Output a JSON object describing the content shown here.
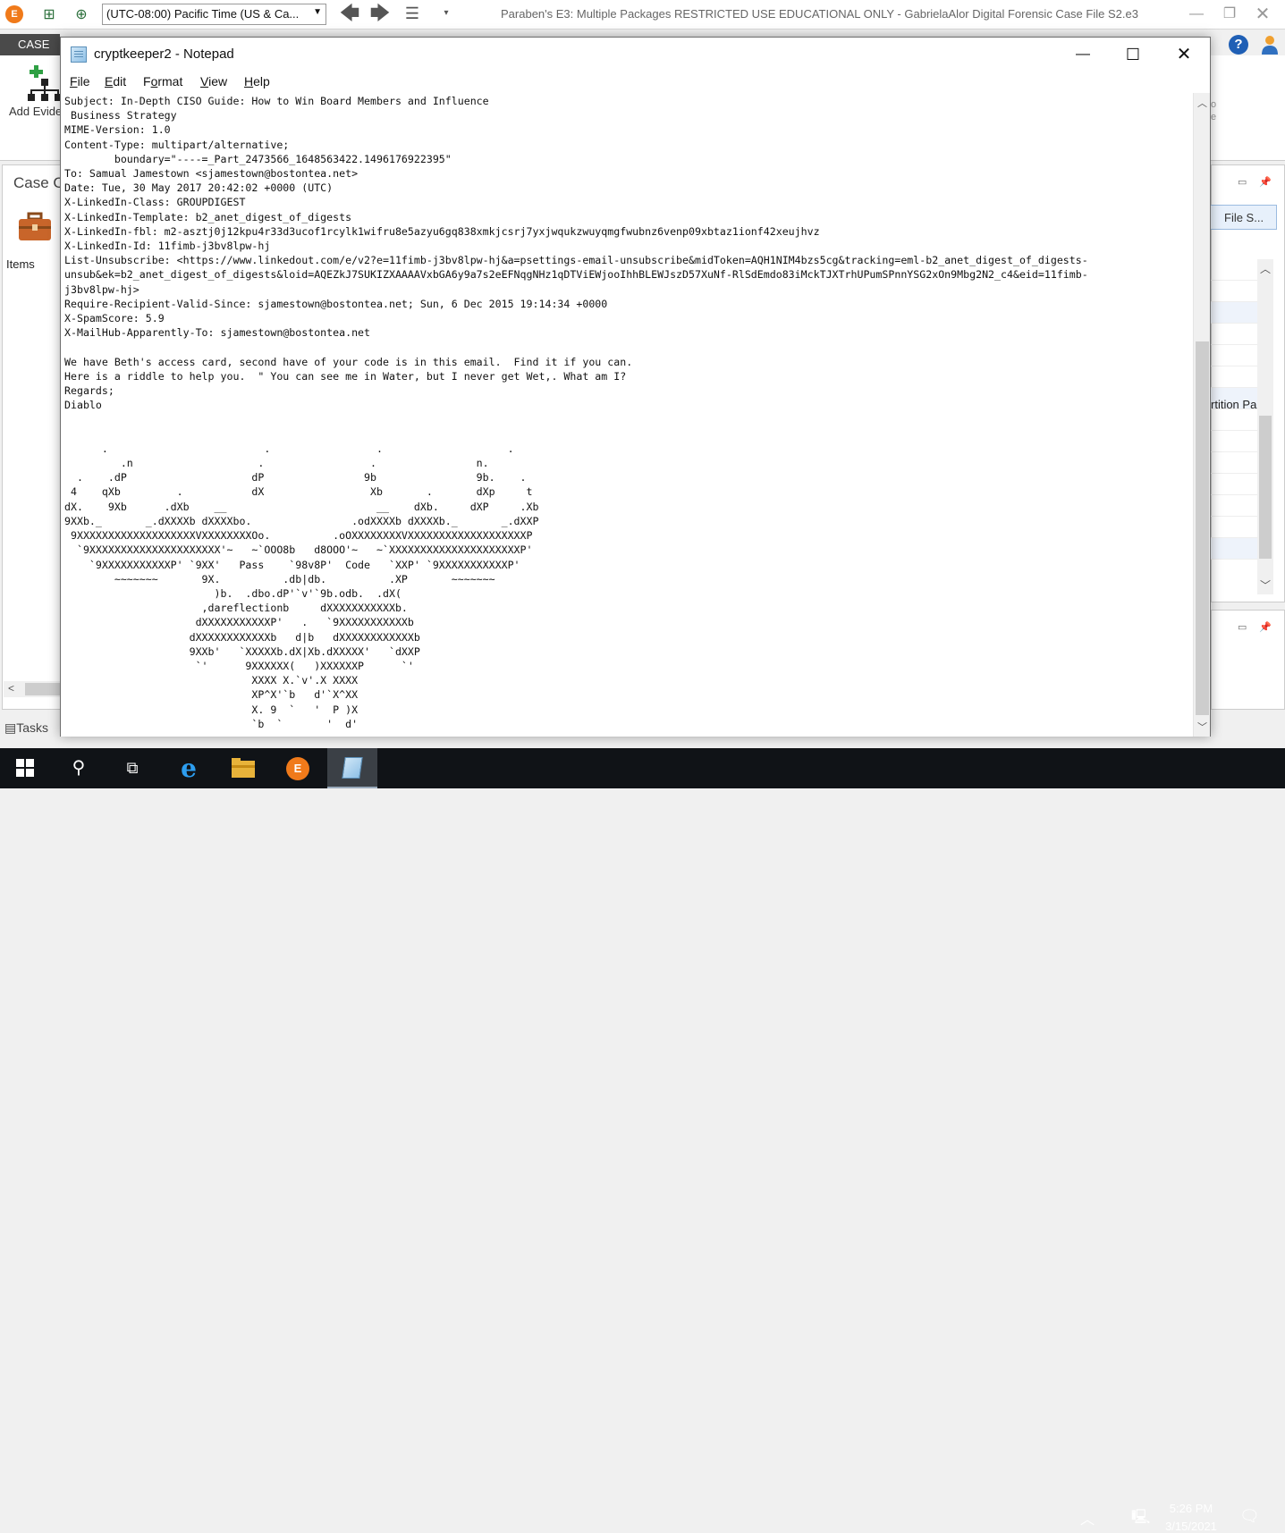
{
  "e3": {
    "timezone": "(UTC-08:00) Pacific Time (US & Ca...",
    "title": "Paraben's E3: Multiple Packages RESTRICTED USE EDUCATIONAL ONLY - GabrielaAlor Digital Forensic Case File S2.e3",
    "ribbon_tab": "CASE",
    "add_evidence_label": "Add Evide",
    "case_panel_title": "Case C",
    "items_label": "Items",
    "tasks_label": "Tasks",
    "right_tab_label": "File S...",
    "right_partition_label": "rtition Pa",
    "ribbon_right_text": "o\ne"
  },
  "notepad": {
    "title": "cryptkeeper2 - Notepad",
    "menu": [
      {
        "label": "File",
        "key": "F",
        "rest": "ile"
      },
      {
        "label": "Edit",
        "key": "E",
        "rest": "dit"
      },
      {
        "label": "Format",
        "key": "o",
        "pre": "F",
        "rest": "rmat"
      },
      {
        "label": "View",
        "key": "V",
        "rest": "iew"
      },
      {
        "label": "Help",
        "key": "H",
        "rest": "elp"
      }
    ],
    "content": "Subject: In-Depth CISO Guide: How to Win Board Members and Influence\n Business Strategy\nMIME-Version: 1.0\nContent-Type: multipart/alternative;\n        boundary=\"----=_Part_2473566_1648563422.1496176922395\"\nTo: Samual Jamestown <sjamestown@bostontea.net>\nDate: Tue, 30 May 2017 20:42:02 +0000 (UTC)\nX-LinkedIn-Class: GROUPDIGEST\nX-LinkedIn-Template: b2_anet_digest_of_digests\nX-LinkedIn-fbl: m2-asztj0j12kpu4r33d3ucof1rcylk1wifru8e5azyu6gq838xmkjcsrj7yxjwqukzwuyqmgfwubnz6venp09xbtaz1ionf42xeujhvz\nX-LinkedIn-Id: 11fimb-j3bv8lpw-hj\nList-Unsubscribe: <https://www.linkedout.com/e/v2?e=11fimb-j3bv8lpw-hj&a=psettings-email-unsubscribe&midToken=AQH1NIM4bzs5cg&tracking=eml-b2_anet_digest_of_digests-\nunsub&ek=b2_anet_digest_of_digests&loid=AQEZkJ7SUKIZXAAAAVxbGA6y9a7s2eEFNqgNHz1qDTViEWjooIhhBLEWJszD57XuNf-RlSdEmdo83iMckTJXTrhUPumSPnnYSG2xOn9Mbg2N2_c4&eid=11fimb-\nj3bv8lpw-hj>\nRequire-Recipient-Valid-Since: sjamestown@bostontea.net; Sun, 6 Dec 2015 19:14:34 +0000\nX-SpamScore: 5.9\nX-MailHub-Apparently-To: sjamestown@bostontea.net\n\nWe have Beth's access card, second have of your code is in this email.  Find it if you can.\nHere is a riddle to help you.  \" You can see me in Water, but I never get Wet,. What am I?\nRegards;\nDiablo\n\n\n      .                         .                 .                    .\n         .n                    .                 .                n.\n  .    .dP                    dP                9b                9b.    .\n 4    qXb         .           dX                 Xb       .       dXp     t\ndX.    9Xb      .dXb    __                        __    dXb.     dXP     .Xb\n9XXb._       _.dXXXXb dXXXXbo.                .odXXXXb dXXXXb._       _.dXXP\n 9XXXXXXXXXXXXXXXXXXXVXXXXXXXXOo.          .oOXXXXXXXXVXXXXXXXXXXXXXXXXXXXP\n  `9XXXXXXXXXXXXXXXXXXXXX'~   ~`OOO8b   d8OOO'~   ~`XXXXXXXXXXXXXXXXXXXXXP'\n    `9XXXXXXXXXXXP' `9XX'   Pass    `98v8P'  Code   `XXP' `9XXXXXXXXXXXP'\n        ~~~~~~~       9X.          .db|db.          .XP       ~~~~~~~\n                        )b.  .dbo.dP'`v'`9b.odb.  .dX(\n                      ,dareflectionb     dXXXXXXXXXXXb.\n                     dXXXXXXXXXXXP'   .   `9XXXXXXXXXXXb\n                    dXXXXXXXXXXXXb   d|b   dXXXXXXXXXXXXb\n                    9XXb'   `XXXXXb.dX|Xb.dXXXXX'   `dXXP\n                     `'      9XXXXXX(   )XXXXXXP      `'\n                              XXXX X.`v'.X XXXX\n                              XP^X'`b   d'`X^XX\n                              X. 9  `   '  P )X\n                              `b  `       '  d'"
  },
  "taskbar": {
    "time": "5:26 PM",
    "date": "3/15/2021"
  }
}
